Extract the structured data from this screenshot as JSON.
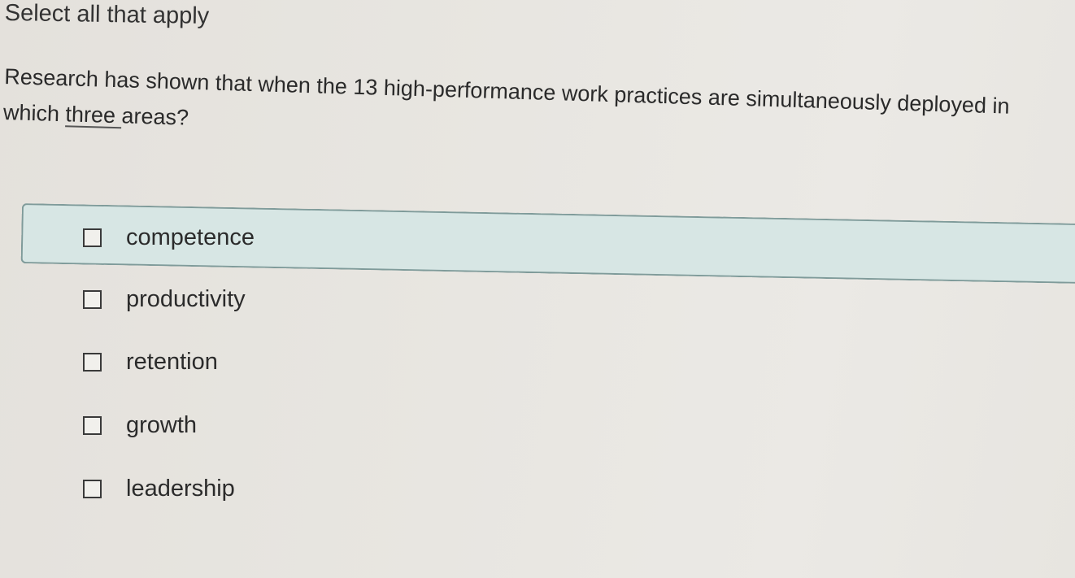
{
  "instruction": "Select all that apply",
  "question": {
    "line1": "Research has shown that when the 13 high-performance work practices are simultaneously deployed in",
    "line2_prefix": "which ",
    "line2_underlined": "three ",
    "line2_suffix": "areas?"
  },
  "options": [
    {
      "label": "competence",
      "checked": false,
      "highlighted": true
    },
    {
      "label": "productivity",
      "checked": false,
      "highlighted": false
    },
    {
      "label": "retention",
      "checked": false,
      "highlighted": false
    },
    {
      "label": "growth",
      "checked": false,
      "highlighted": false
    },
    {
      "label": "leadership",
      "checked": false,
      "highlighted": false
    }
  ],
  "colors": {
    "highlight_background": "#d7e6e4",
    "highlight_border": "#7f9b9a",
    "text": "#2b2b2b"
  }
}
